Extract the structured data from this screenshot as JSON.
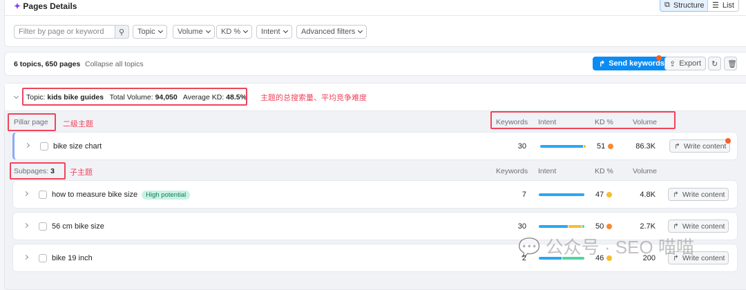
{
  "header": {
    "title": "Pages Details",
    "view_structure": "Structure",
    "view_list": "List"
  },
  "filters": {
    "search_placeholder": "Filter by page or keyword",
    "topic": "Topic",
    "volume": "Volume",
    "kd": "KD %",
    "intent": "Intent",
    "advanced": "Advanced filters"
  },
  "summary": {
    "count": "6 topics, 650 pages",
    "collapse": "Collapse all topics",
    "send": "Send keywords",
    "export": "Export"
  },
  "topic": {
    "label": "Topic:",
    "name": "kids bike guides",
    "vol_label": "Total Volume:",
    "vol": "94,050",
    "kd_label": "Average KD:",
    "kd": "48.5%"
  },
  "columns": {
    "keywords": "Keywords",
    "intent": "Intent",
    "kd": "KD %",
    "volume": "Volume"
  },
  "pillar": {
    "label": "Pillar page",
    "row": {
      "name": "bike size chart",
      "keywords": "30",
      "kd": "51",
      "volume": "86.3K",
      "action": "Write content"
    }
  },
  "subpages": {
    "label": "Subpages:",
    "count": "3",
    "rows": [
      {
        "name": "how to measure bike size",
        "badge": "High potential",
        "keywords": "7",
        "kd": "47",
        "volume": "4.8K",
        "action": "Write content"
      },
      {
        "name": "56 cm bike size",
        "keywords": "30",
        "kd": "50",
        "volume": "2.7K",
        "action": "Write content"
      },
      {
        "name": "bike 19 inch",
        "keywords": "2",
        "kd": "46",
        "volume": "200",
        "action": "Write content"
      }
    ]
  },
  "annotations": {
    "topic": "主题的总搜索量、平均竞争难度",
    "pillar": "二级主题",
    "sub": "子主题"
  },
  "watermark": "公众号 · SEO 喵喵",
  "colors": {
    "accent": "#0b8cf5",
    "annotation": "#f0435a",
    "kd_orange": "#f58a33",
    "kd_yellow": "#f6bd2f"
  }
}
